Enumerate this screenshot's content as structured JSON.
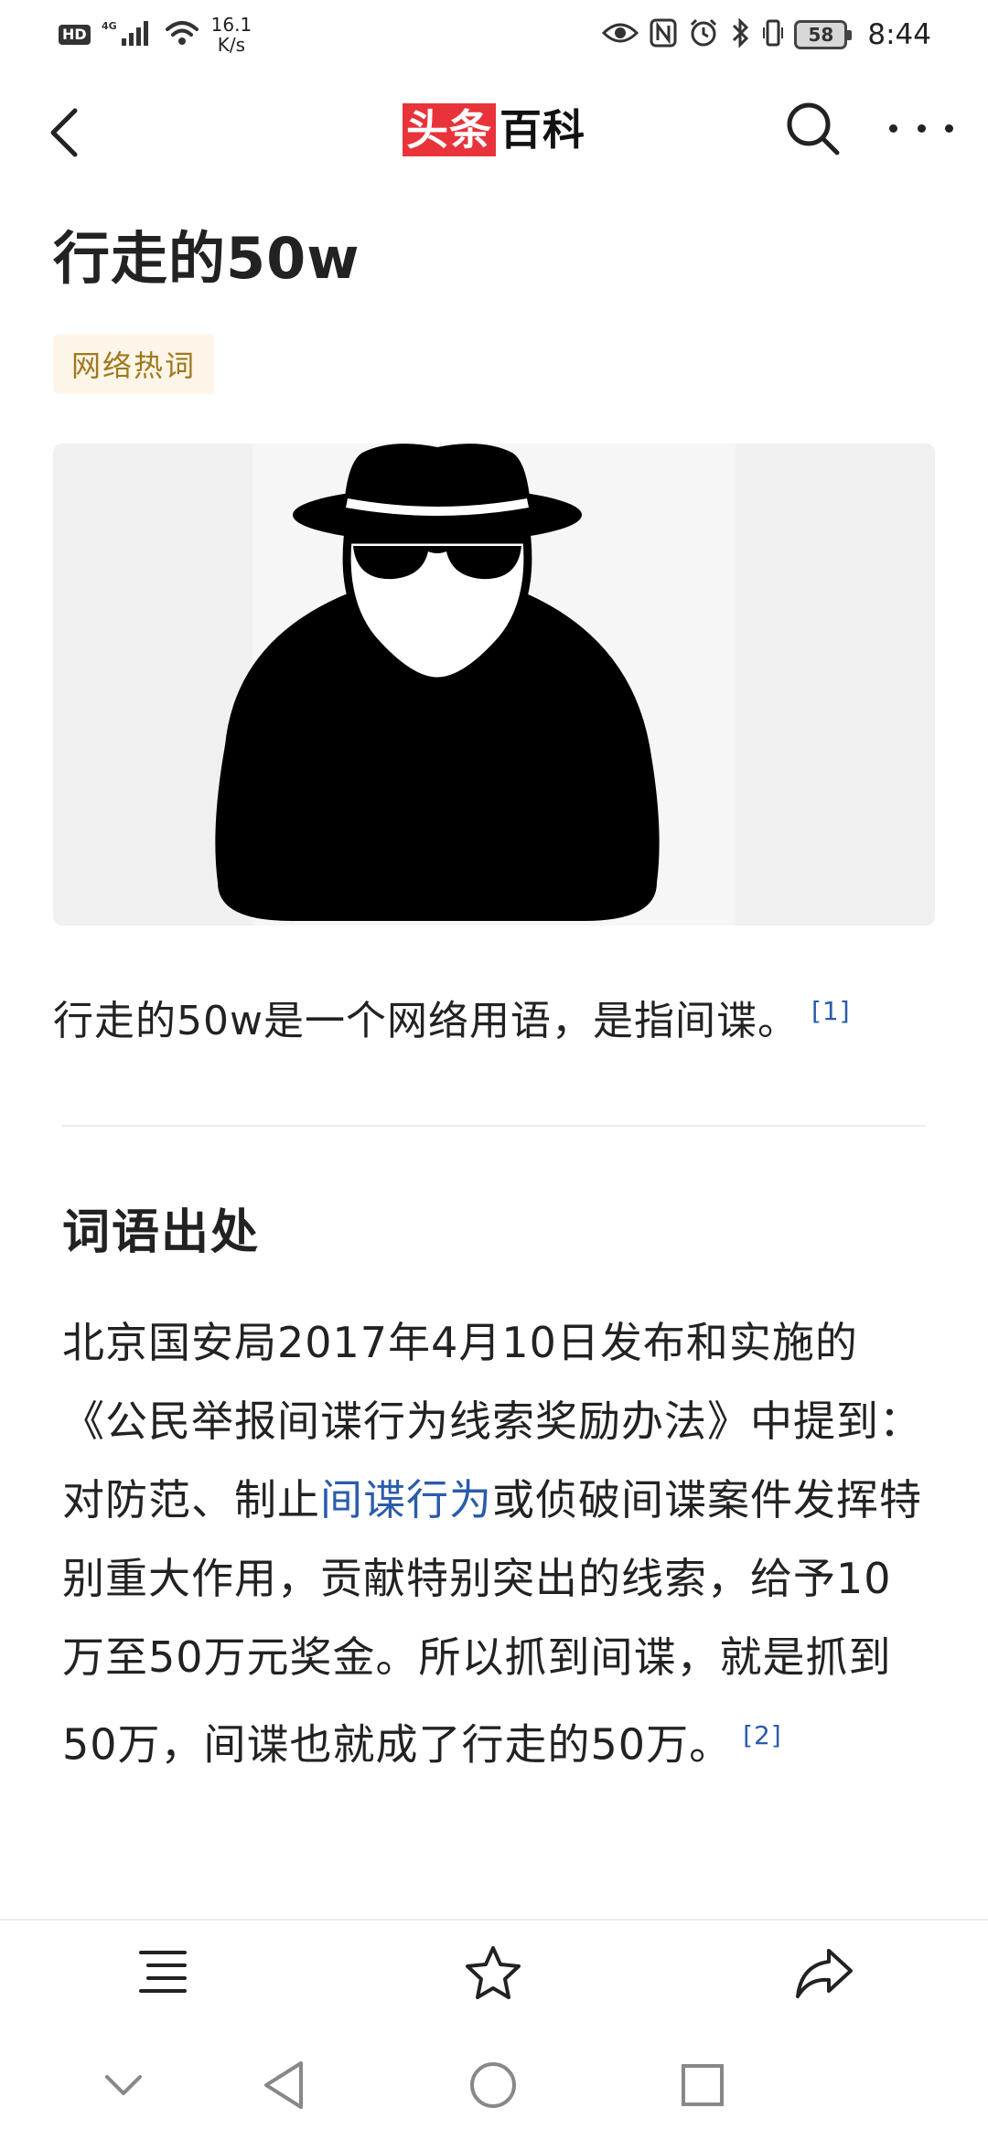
{
  "status_bar": {
    "hd": "HD",
    "signal_label": "4G",
    "speed_value": "16.1",
    "speed_unit": "K/s",
    "battery": "58",
    "time": "8:44"
  },
  "header": {
    "brand_part1": "头条",
    "brand_part2": "百科"
  },
  "article": {
    "title": "行走的50w",
    "tag": "网络热词",
    "definition": "行走的50w是一个网络用语，是指间谍。",
    "definition_ref": "[1]"
  },
  "section": {
    "title": "词语出处",
    "text_before_link": "北京国安局2017年4月10日发布和实施的《公民举报间谍行为线索奖励办法》中提到：对防范、制止",
    "link_text": "间谍行为",
    "text_after_link": "或侦破间谍案件发挥特别重大作用，贡献特别突出的线索，给予10万至50万元奖金。所以抓到间谍，就是抓到50万，间谍也就成了行走的50万。",
    "ref": "[2]"
  },
  "icons": {
    "back": "back-arrow-icon",
    "search": "search-icon",
    "more": "more-icon",
    "contents": "contents-list-icon",
    "favorite": "star-icon",
    "share": "share-icon"
  },
  "colors": {
    "brand_red": "#e8333a",
    "link_blue": "#2a5cab",
    "tag_bg": "#fdf6e8",
    "tag_text": "#a0781e"
  }
}
